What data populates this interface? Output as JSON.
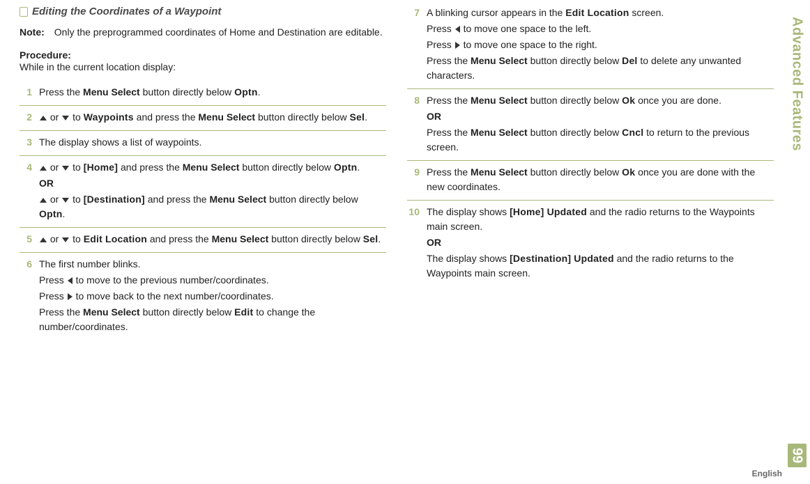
{
  "side": {
    "title": "Advanced Features",
    "pageNum": "99",
    "lang": "English"
  },
  "heading": "Editing the Coordinates of a Waypoint",
  "note": {
    "label": "Note:",
    "text": "Only the preprogrammed coordinates of Home and Destination are editable."
  },
  "procLabel": "Procedure:",
  "procIntro": "While in the current location display:",
  "btn": {
    "menuSelect": "Menu Select"
  },
  "ui": {
    "optn": "Optn",
    "waypoints": "Waypoints",
    "sel": "Sel",
    "home": "[Home]",
    "destination": "[Destination]",
    "editLocation": "Edit Location",
    "edit": "Edit",
    "del": "Del",
    "ok": "Ok",
    "cncl": "Cncl",
    "homeUpdated": "[Home] Updated",
    "destUpdated": "[Destination] Updated"
  },
  "txt": {
    "or": " or ",
    "to": " to ",
    "pressThe": "Press the ",
    "andPressThe": " and press the ",
    "btnBelow": " button directly below ",
    "orWord": "OR",
    "s1_a": "Press the ",
    "s1_b": ".",
    "s2_c": ".",
    "s3": "The display shows a list of waypoints.",
    "s4_c": ".",
    "s5_c": ".",
    "s6a": "The first number blinks.",
    "s6b_a": "Press ",
    "s6b_b": " to move to the previous number/coordinates.",
    "s6c_a": "Press ",
    "s6c_b": " to move back to the next number/coordinates.",
    "s6d_a": "Press the ",
    "s6d_b": " to change the number/coordinates.",
    "s7a_a": "A blinking cursor appears in the ",
    "s7a_b": " screen.",
    "s7b_a": "Press ",
    "s7b_b": " to move one space to the left.",
    "s7c_a": "Press ",
    "s7c_b": " to move one space to the right.",
    "s7d_a": "Press the ",
    "s7d_b": " to delete any unwanted characters.",
    "s8a_a": "Press the ",
    "s8a_b": " once you are done.",
    "s8b_a": "Press the ",
    "s8b_b": " to return to the previous screen.",
    "s9_a": "Press the ",
    "s9_b": " once you are done with the new coordinates.",
    "s10a_a": "The display shows ",
    "s10a_b": " and the radio returns to the Waypoints main screen.",
    "s10b_a": "The display shows ",
    "s10b_b": " and the radio returns to the Waypoints main screen."
  },
  "nums": {
    "n1": "1",
    "n2": "2",
    "n3": "3",
    "n4": "4",
    "n5": "5",
    "n6": "6",
    "n7": "7",
    "n8": "8",
    "n9": "9",
    "n10": "10"
  }
}
